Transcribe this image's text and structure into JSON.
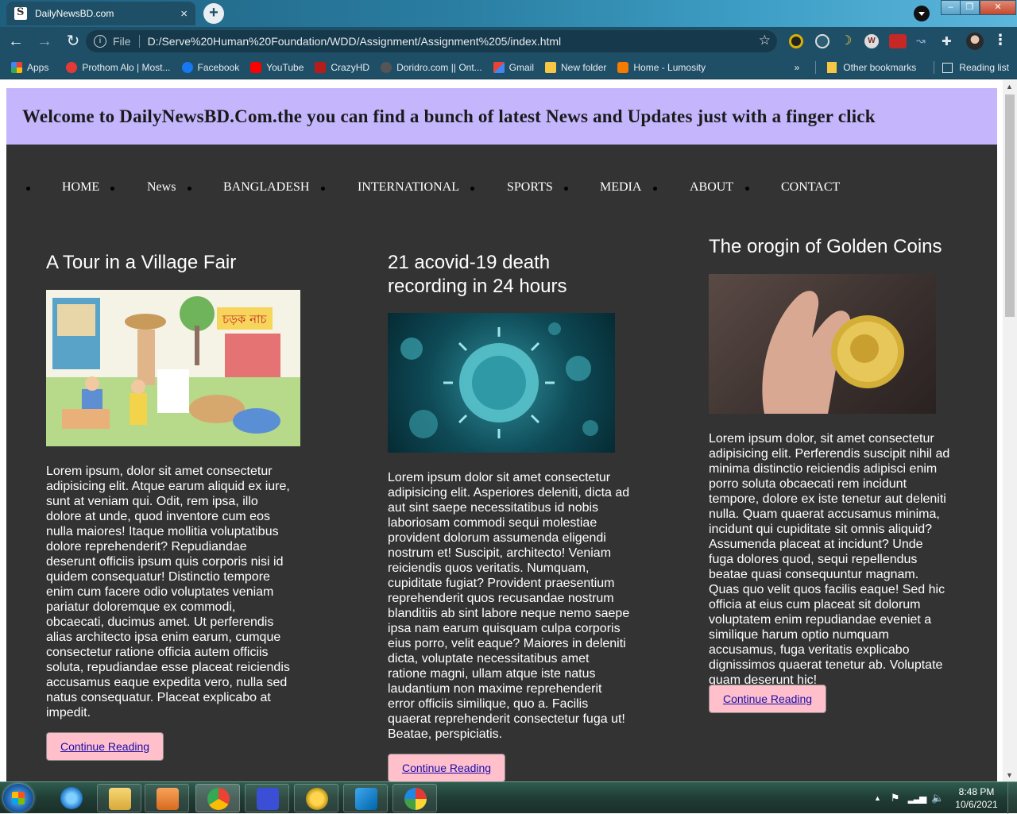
{
  "browser": {
    "tab_title": "DailyNewsBD.com",
    "tab_close": "×",
    "new_tab": "+",
    "address_scheme": "File",
    "address_url": "D:/Serve%20Human%20Foundation/WDD/Assignment/Assignment%205/index.html",
    "bookmarks": [
      {
        "label": "Apps",
        "color": "#e64a19"
      },
      {
        "label": "Prothom Alo | Most...",
        "color": "#e53935"
      },
      {
        "label": "Facebook",
        "color": "#1877f2"
      },
      {
        "label": "YouTube",
        "color": "#ff0000"
      },
      {
        "label": "CrazyHD",
        "color": "#b71c1c"
      },
      {
        "label": "Doridro.com || Ont...",
        "color": "#555555"
      },
      {
        "label": "Gmail",
        "color": "#ea4335"
      },
      {
        "label": "New folder",
        "color": "#f6c744"
      },
      {
        "label": "Home - Lumosity",
        "color": "#f57c00"
      }
    ],
    "bookmarks_overflow": "»",
    "other_bookmarks": "Other bookmarks",
    "reading_list": "Reading list"
  },
  "page": {
    "welcome": "Welcome to DailyNewsBD.Com.the you can find a bunch of latest News and Updates just with a finger click",
    "nav": [
      "HOME",
      "News",
      "BANGLADESH",
      "INTERNATIONAL",
      "SPORTS",
      "MEDIA",
      "ABOUT",
      "CONTACT"
    ],
    "articles": [
      {
        "title": "A Tour in a Village Fair",
        "body": "Lorem ipsum, dolor sit amet consectetur adipisicing elit. Atque earum aliquid ex iure, sunt at veniam qui. Odit, rem ipsa, illo dolore at unde, quod inventore cum eos nulla maiores! Itaque mollitia voluptatibus dolore reprehenderit? Repudiandae deserunt officiis ipsum quis corporis nisi id quidem consequatur! Distinctio tempore enim cum facere odio voluptates veniam pariatur doloremque ex commodi, obcaecati, ducimus amet. Ut perferendis alias architecto ipsa enim earum, cumque consectetur ratione officia autem officiis soluta, repudiandae esse placeat reiciendis accusamus eaque expedita vero, nulla sed natus consequatur. Placeat explicabo at impedit.",
        "button": "Continue Reading",
        "image_sign": "চড়ক নাচ"
      },
      {
        "title": "21 acovid-19 death recording in 24 hours",
        "body": "Lorem ipsum dolor sit amet consectetur adipisicing elit. Asperiores deleniti, dicta ad aut sint saepe necessitatibus id nobis laboriosam commodi sequi molestiae provident dolorum assumenda eligendi nostrum et! Suscipit, architecto! Veniam reiciendis quos veritatis. Numquam, cupiditate fugiat? Provident praesentium reprehenderit quos recusandae nostrum blanditiis ab sint labore neque nemo saepe ipsa nam earum quisquam culpa corporis eius porro, velit eaque? Maiores in deleniti dicta, voluptate necessitatibus amet ratione magni, ullam atque iste natus laudantium non maxime reprehenderit error officiis similique, quo a. Facilis quaerat reprehenderit consectetur fuga ut! Beatae, perspiciatis.",
        "button": "Continue Reading"
      },
      {
        "title": "The orogin of Golden Coins",
        "body": "Lorem ipsum dolor, sit amet consectetur adipisicing elit. Perferendis suscipit nihil ad minima distinctio reiciendis adipisci enim porro soluta obcaecati rem incidunt tempore, dolore ex iste tenetur aut deleniti nulla. Quam quaerat accusamus minima, incidunt qui cupiditate sit omnis aliquid? Assumenda placeat at incidunt? Unde fuga dolores quod, sequi repellendus beatae quasi consequuntur magnam. Quas quo velit quos facilis eaque! Sed hic officia at eius cum placeat sit dolorum voluptatem enim repudiandae eveniet a similique harum optio numquam accusamus, fuga veritatis explicabo dignissimos quaerat tenetur ab. Voluptate quam deserunt hic!",
        "button": "Continue Reading"
      }
    ]
  },
  "taskbar": {
    "time": "8:48 PM",
    "date": "10/6/2021"
  },
  "colors": {
    "page_bg": "#333333",
    "banner_bg": "#c4b5fd",
    "button_bg": "#ffc0cb",
    "link": "#1a0dab"
  }
}
